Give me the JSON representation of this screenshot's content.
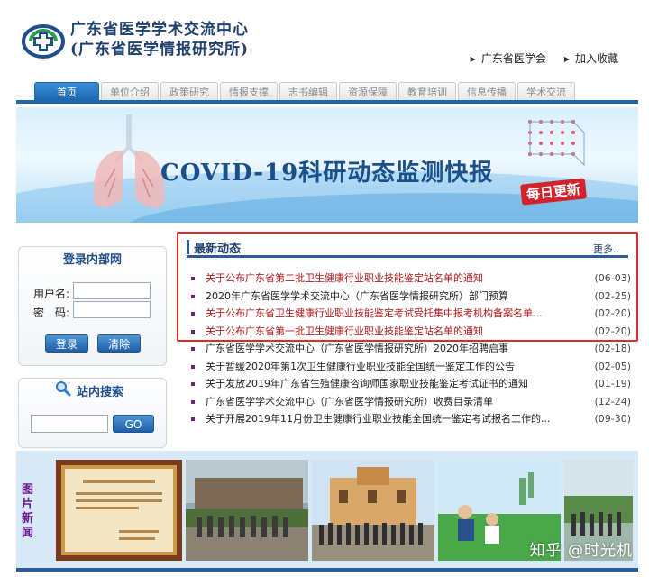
{
  "header": {
    "title_line1": "广东省医学学术交流中心",
    "title_line2": "(广东省医学情报研究所)",
    "links": [
      "广东省医学会",
      "加入收藏"
    ]
  },
  "nav": {
    "items": [
      "首页",
      "单位介绍",
      "政策研究",
      "情报支撑",
      "志书编辑",
      "资源保障",
      "教育培训",
      "信息传播",
      "学术交流"
    ],
    "active_index": 0
  },
  "banner": {
    "title": "COVID-19科研动态监测快报",
    "badge": "每日更新"
  },
  "login": {
    "title": "登录内部网",
    "username_label": "用户名:",
    "password_label": "密　码:",
    "login_button": "登录",
    "clear_button": "清除"
  },
  "search": {
    "title": "站内搜索",
    "go_button": "GO"
  },
  "news": {
    "title": "最新动态",
    "more": "更多..",
    "items": [
      {
        "title": "关于公布广东省第二批卫生健康行业职业技能鉴定站名单的通知",
        "date": "(06-03)",
        "style": "red"
      },
      {
        "title": "2020年广东省医学学术交流中心（广东省医学情报研究所）部门预算",
        "date": "(02-25)",
        "style": "dark"
      },
      {
        "title": "关于公布广东省卫生健康行业职业技能鉴定考试受托集中报考机构备案名单...",
        "date": "(02-20)",
        "style": "red"
      },
      {
        "title": "关于公布广东省第一批卫生健康行业职业技能鉴定站名单的通知",
        "date": "(02-20)",
        "style": "red"
      },
      {
        "title": "广东省医学学术交流中心（广东省医学情报研究所）2020年招聘启事",
        "date": "(02-18)",
        "style": "dark"
      },
      {
        "title": "关于暂缓2020年第1次卫生健康行业职业技能全国统一鉴定工作的公告",
        "date": "(02-05)",
        "style": "dark"
      },
      {
        "title": "关于发放2019年广东省生殖健康咨询师国家职业技能鉴定考试证书的通知",
        "date": "(01-19)",
        "style": "dark"
      },
      {
        "title": "广东省医学学术交流中心（广东省医学情报研究所）收费目录清单",
        "date": "(12-24)",
        "style": "dark"
      },
      {
        "title": "关于开展2019年11月份卫生健康行业职业技能全国统一鉴定考试报名工作的...",
        "date": "(09-30)",
        "style": "dark"
      }
    ]
  },
  "pictures": {
    "label": "图片新闻",
    "watermark": "知乎 @时光机"
  }
}
